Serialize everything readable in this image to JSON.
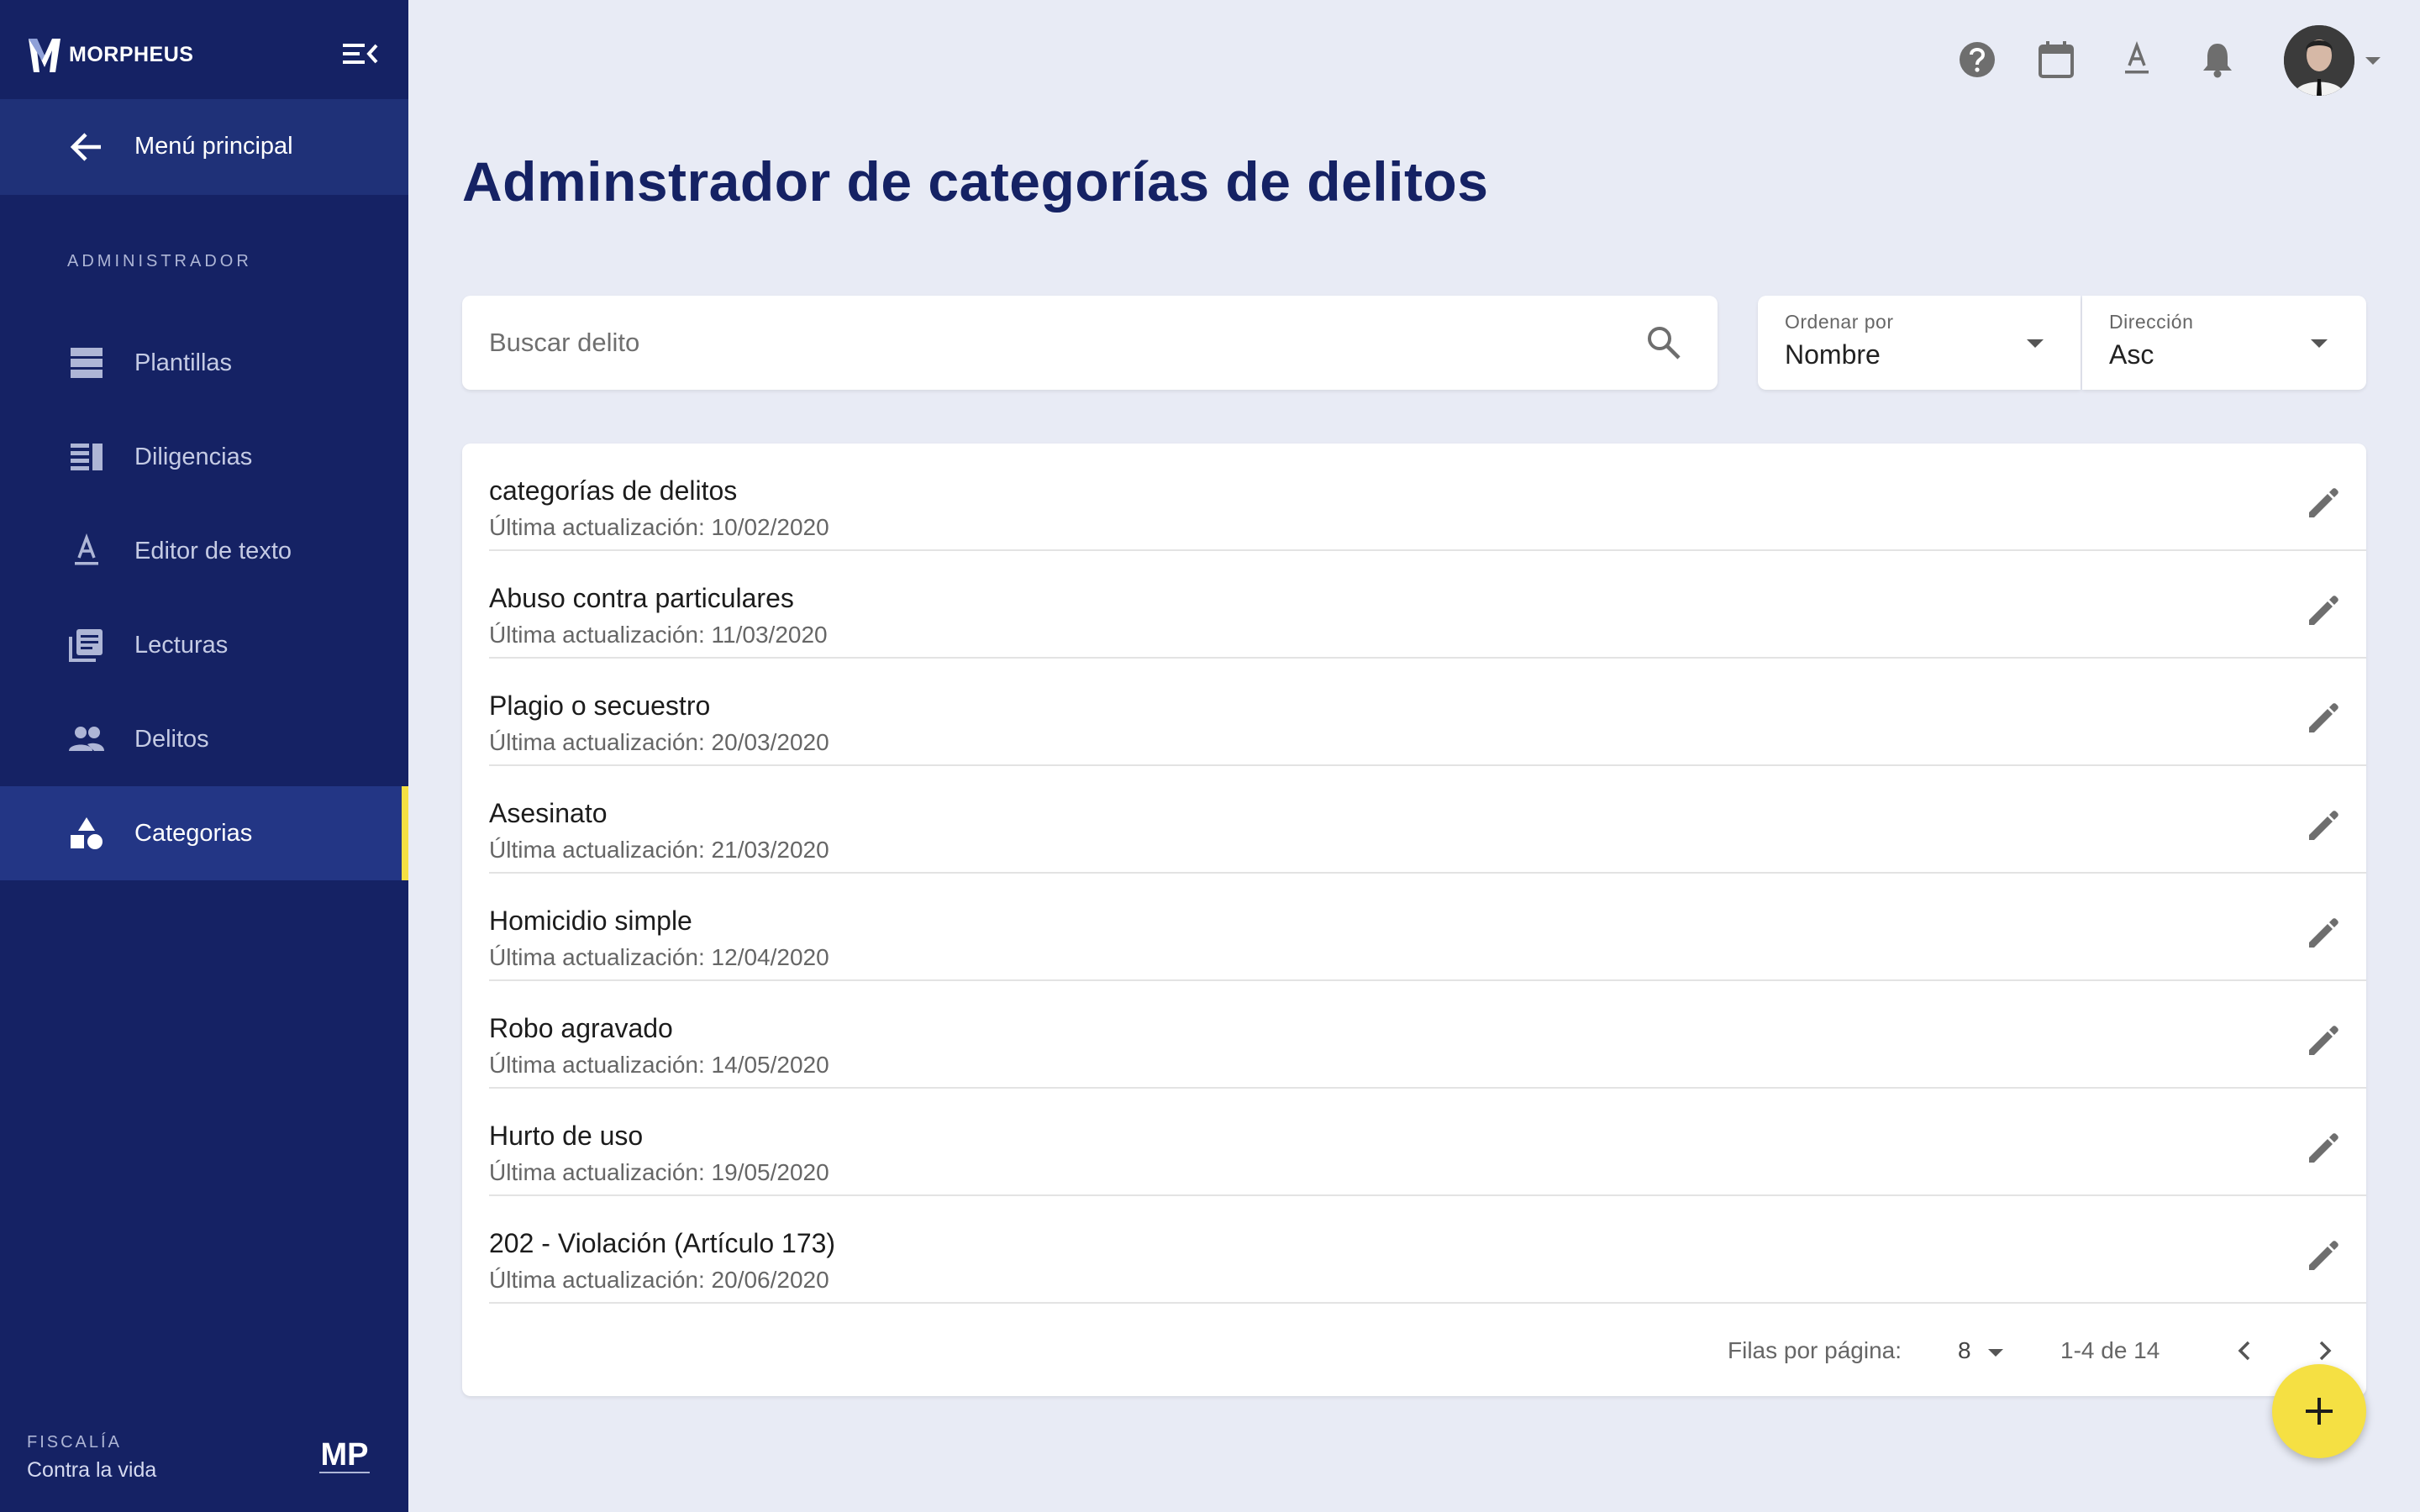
{
  "brand": {
    "name": "MORPHEUS",
    "logo_icon": "morpheus-m-logo"
  },
  "sidebar": {
    "back_label": "Menú principal",
    "section_label": "ADMINISTRADOR",
    "items": [
      {
        "label": "Plantillas",
        "icon": "view-list-icon"
      },
      {
        "label": "Diligencias",
        "icon": "view-quilt-icon"
      },
      {
        "label": "Editor de texto",
        "icon": "text-format-icon"
      },
      {
        "label": "Lecturas",
        "icon": "library-books-icon"
      },
      {
        "label": "Delitos",
        "icon": "people-icon"
      },
      {
        "label": "Categorias",
        "icon": "category-icon",
        "active": true
      }
    ],
    "footer_title": "FISCALÍA",
    "footer_subtitle": "Contra la vida",
    "footer_logo": "MP"
  },
  "colors": {
    "sidebar_bg": "#152264",
    "accent": "#f5e043",
    "page_bg": "#e8ebf5",
    "title": "#152264"
  },
  "header": {
    "icons": [
      "help-icon",
      "calendar-icon",
      "text-format-icon",
      "notifications-icon"
    ],
    "title": "Adminstrador de categorías de delitos"
  },
  "search": {
    "placeholder": "Buscar delito",
    "value": ""
  },
  "sort": {
    "label": "Ordenar por",
    "value": "Nombre"
  },
  "direction": {
    "label": "Dirección",
    "value": "Asc"
  },
  "rows": [
    {
      "title": "categorías de delitos",
      "subtitle": "Última actualización: 10/02/2020"
    },
    {
      "title": "Abuso contra particulares",
      "subtitle": "Última actualización: 11/03/2020"
    },
    {
      "title": "Plagio o secuestro",
      "subtitle": "Última actualización: 20/03/2020"
    },
    {
      "title": "Asesinato",
      "subtitle": "Última actualización: 21/03/2020"
    },
    {
      "title": "Homicidio simple",
      "subtitle": "Última actualización: 12/04/2020"
    },
    {
      "title": "Robo agravado",
      "subtitle": "Última actualización: 14/05/2020"
    },
    {
      "title": "Hurto de uso",
      "subtitle": "Última actualización: 19/05/2020"
    },
    {
      "title": "202 - Violación (Artículo 173)",
      "subtitle": "Última actualización: 20/06/2020"
    }
  ],
  "pagination": {
    "rows_label": "Filas por página:",
    "rows_value": "8",
    "range": "1-4 de 14"
  }
}
